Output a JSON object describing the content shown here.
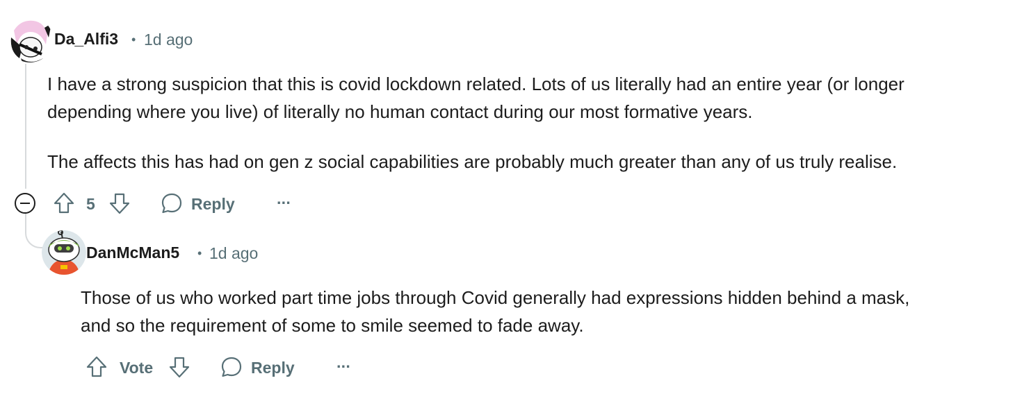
{
  "comments": [
    {
      "username": "Da_Alfi3",
      "separator": "•",
      "time": "1d ago",
      "paragraphs": [
        "I have a strong suspicion that this is covid lockdown related. Lots of us literally had an entire year (or longer",
        "depending where you live) of literally no human contact during our most formative years.",
        "The affects this has had on gen z social capabilities are probably much greater than any of us truly realise."
      ],
      "score": "5",
      "reply_label": "Reply",
      "more_label": "···"
    },
    {
      "username": "DanMcMan5",
      "separator": "•",
      "time": "1d ago",
      "paragraphs": [
        "Those of us who worked part time jobs through Covid generally had expressions hidden behind a mask,",
        "and so the requirement of some to smile seemed to fade away."
      ],
      "vote_label": "Vote",
      "reply_label": "Reply",
      "more_label": "···"
    }
  ],
  "colors": {
    "text": "#1c1c1c",
    "meta": "#576f76",
    "thread_line": "#d7dadc"
  }
}
